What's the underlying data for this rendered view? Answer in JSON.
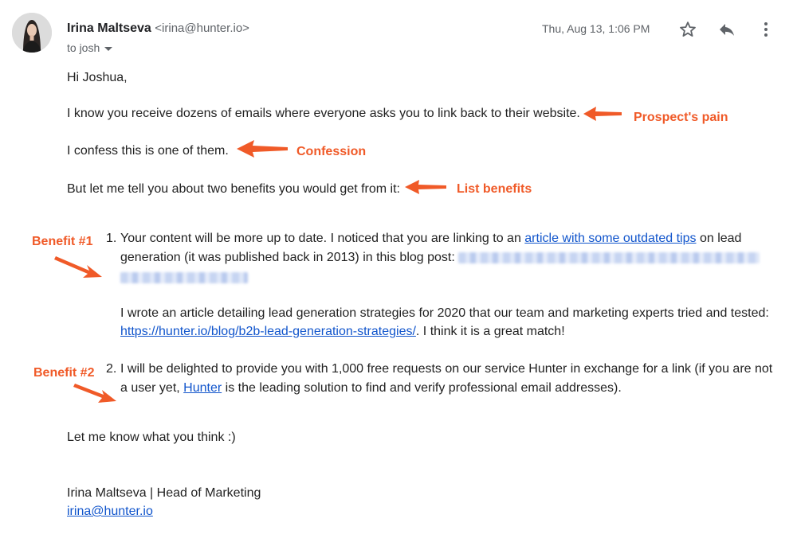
{
  "header": {
    "sender_name": "Irina Maltseva",
    "sender_email": "<irina@hunter.io>",
    "to_label": "to josh",
    "date": "Thu, Aug 13, 1:06 PM",
    "icons": {
      "star": "star-icon",
      "reply": "reply-icon",
      "more": "more-vert-icon"
    }
  },
  "email": {
    "greeting": "Hi Joshua,",
    "para1": "I know you receive dozens of emails where everyone asks you to link back to their website.",
    "para2": "I confess this is one of them.",
    "para3": "But let me tell you about two benefits you would get from it:",
    "item1": {
      "number": "1.",
      "line1_a": "Your content will be more up to date. I noticed that you are linking to an ",
      "line1_link": "article with some outdated tips",
      "line1_b": " on lead",
      "line2": "generation (it was published back in 2013) in this blog post: ",
      "para2_line1": "I wrote an article detailing lead generation strategies for 2020 that our team and marketing experts tried and tested:",
      "para2_link": "https://hunter.io/blog/b2b-lead-generation-strategies/",
      "para2_tail": ". I think it is a great match!"
    },
    "item2": {
      "number": "2.",
      "line1": "I will be delighted to provide you with 1,000 free requests on our service Hunter in exchange for a link (if you are not",
      "line2_a": "a user yet, ",
      "line2_link": "Hunter",
      "line2_b": " is the leading solution to find and verify professional email addresses)."
    },
    "closing": "Let me know what you think :)",
    "signature_name": "Irina Maltseva | Head of Marketing",
    "signature_email": "irina@hunter.io"
  },
  "annotations": {
    "pain": "Prospect's pain",
    "confession": "Confession",
    "benefits": "List benefits",
    "benefit1": "Benefit #1",
    "benefit2": "Benefit #2",
    "color": "#f05a28"
  }
}
